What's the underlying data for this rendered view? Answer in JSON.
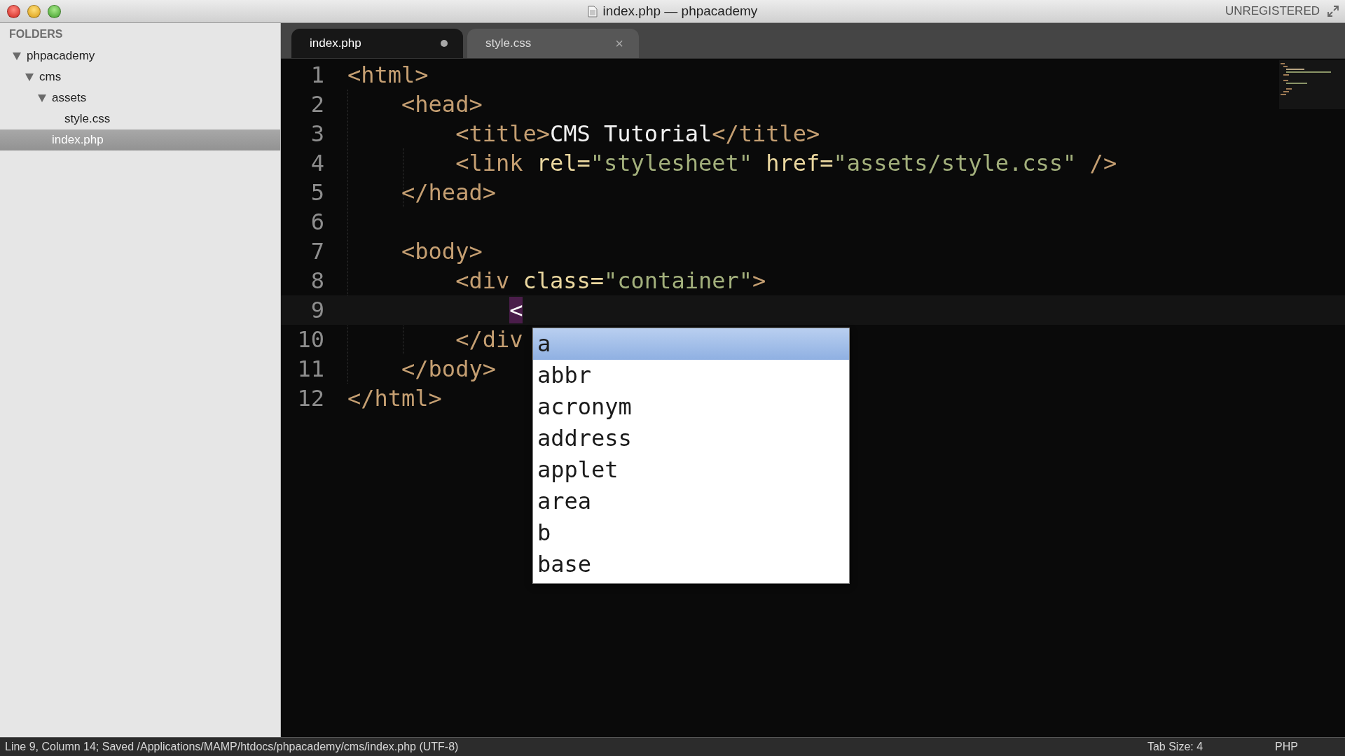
{
  "window": {
    "title": "index.php — phpacademy",
    "badge": "UNREGISTERED"
  },
  "sidebar": {
    "heading": "FOLDERS",
    "tree": [
      {
        "kind": "folder",
        "label": "phpacademy",
        "expanded": true,
        "selected": false,
        "children": [
          {
            "kind": "folder",
            "label": "cms",
            "expanded": true,
            "selected": false,
            "children": [
              {
                "kind": "folder",
                "label": "assets",
                "expanded": true,
                "selected": false,
                "children": [
                  {
                    "kind": "file",
                    "label": "style.css",
                    "selected": false
                  }
                ]
              },
              {
                "kind": "file",
                "label": "index.php",
                "selected": true
              }
            ]
          }
        ]
      }
    ]
  },
  "tabs": [
    {
      "label": "index.php",
      "selected": true,
      "modified": true
    },
    {
      "label": "style.css",
      "selected": false,
      "modified": false,
      "close": "×"
    }
  ],
  "editor": {
    "lines": [
      {
        "number": "1",
        "tokens": [
          {
            "kind": "tag",
            "text": "<html>"
          }
        ]
      },
      {
        "number": "2",
        "tokens": [
          {
            "kind": "tag",
            "text": "    <head>"
          }
        ]
      },
      {
        "number": "3",
        "tokens": [
          {
            "kind": "tag",
            "text": "        <title>"
          },
          {
            "kind": "text",
            "text": "CMS Tutorial"
          },
          {
            "kind": "tag",
            "text": "</title>"
          }
        ]
      },
      {
        "number": "4",
        "tokens": [
          {
            "kind": "tag",
            "text": "        <link "
          },
          {
            "kind": "attr",
            "text": "rel="
          },
          {
            "kind": "string",
            "text": "\"stylesheet\""
          },
          {
            "kind": "attr",
            "text": " href="
          },
          {
            "kind": "string",
            "text": "\"assets/style.css\""
          },
          {
            "kind": "tag",
            "text": " />"
          }
        ]
      },
      {
        "number": "5",
        "tokens": [
          {
            "kind": "tag",
            "text": "    </head>"
          }
        ]
      },
      {
        "number": "6"
      },
      {
        "number": "7",
        "tokens": [
          {
            "kind": "tag",
            "text": "    <body>"
          }
        ]
      },
      {
        "number": "8",
        "tokens": [
          {
            "kind": "tag",
            "text": "        <div "
          },
          {
            "kind": "attr",
            "text": "class="
          },
          {
            "kind": "string",
            "text": "\"container\""
          },
          {
            "kind": "tag",
            "text": ">"
          }
        ]
      },
      {
        "number": "9",
        "current": true,
        "tokens": [
          {
            "kind": "caret",
            "text": "            <"
          }
        ]
      },
      {
        "number": "10",
        "tokens": [
          {
            "kind": "tag",
            "text": "        </div"
          }
        ]
      },
      {
        "number": "11",
        "tokens": [
          {
            "kind": "tag",
            "text": "    </body>"
          }
        ]
      },
      {
        "number": "12",
        "tokens": [
          {
            "kind": "tag",
            "text": "</html>"
          }
        ]
      }
    ]
  },
  "autocomplete": [
    {
      "label": "a",
      "selected": true
    },
    {
      "label": "abbr",
      "selected": false
    },
    {
      "label": "acronym",
      "selected": false
    },
    {
      "label": "address",
      "selected": false
    },
    {
      "label": "applet",
      "selected": false
    },
    {
      "label": "area",
      "selected": false
    },
    {
      "label": "b",
      "selected": false
    },
    {
      "label": "base",
      "selected": false
    }
  ],
  "status_bar": {
    "message": "Line 9, Column 14; Saved /Applications/MAMP/htdocs/phpacademy/cms/index.php (UTF-8)",
    "tab_size": "Tab Size: 4",
    "syntax": "PHP"
  }
}
